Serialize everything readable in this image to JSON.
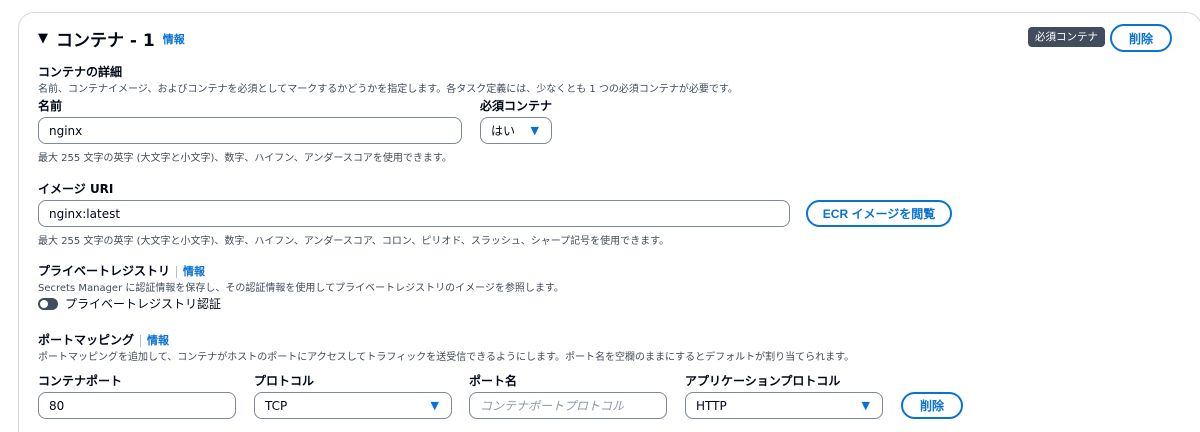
{
  "section": {
    "title": "コンテナ - 1",
    "info_link": "情報",
    "required_badge": "必須コンテナ",
    "delete_label": "削除"
  },
  "details": {
    "heading": "コンテナの詳細",
    "description": "名前、コンテナイメージ、およびコンテナを必須としてマークするかどうかを指定します。各タスク定義には、少なくとも 1 つの必須コンテナが必要です。",
    "name_label": "名前",
    "name_value": "nginx",
    "name_hint": "最大 255 文字の英字 (大文字と小文字)、数字、ハイフン、アンダースコアを使用できます。",
    "essential_label": "必須コンテナ",
    "essential_value": "はい"
  },
  "image": {
    "label": "イメージ URI",
    "value": "nginx:latest",
    "hint": "最大 255 文字の英字 (大文字と小文字)、数字、ハイフン、アンダースコア、コロン、ピリオド、スラッシュ、シャープ記号を使用できます。",
    "browse_label": "ECR イメージを閲覧"
  },
  "registry": {
    "heading": "プライベートレジストリ",
    "info_link": "情報",
    "description": "Secrets Manager に認証情報を保存し、その認証情報を使用してプライベートレジストリのイメージを参照します。",
    "toggle_label": "プライベートレジストリ認証"
  },
  "ports": {
    "heading": "ポートマッピング",
    "info_link": "情報",
    "description": "ポートマッピングを追加して、コンテナがホストのポートにアクセスしてトラフィックを送受信できるようにします。ポート名を空欄のままにするとデフォルトが割り当てられます。",
    "container_port_label": "コンテナポート",
    "container_port_value": "80",
    "protocol_label": "プロトコル",
    "protocol_value": "TCP",
    "port_name_label": "ポート名",
    "port_name_placeholder": "コンテナポートプロトコル",
    "app_protocol_label": "アプリケーションプロトコル",
    "app_protocol_value": "HTTP",
    "delete_label": "削除"
  }
}
